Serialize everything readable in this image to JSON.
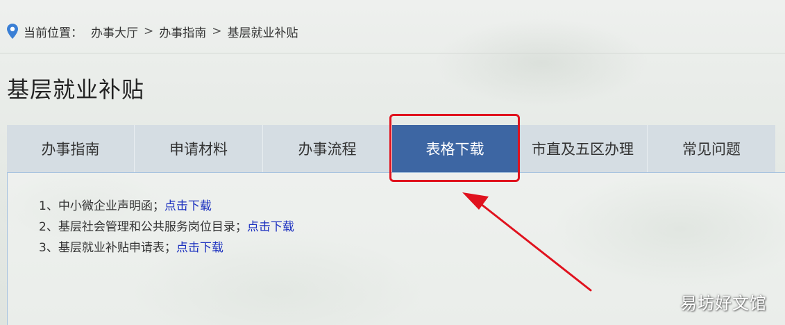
{
  "breadcrumb": {
    "prefix": "当前位置：",
    "items": [
      "办事大厅",
      "办事指南",
      "基层就业补贴"
    ],
    "separator": ">"
  },
  "page": {
    "title": "基层就业补贴"
  },
  "tabs": [
    {
      "label": "办事指南",
      "active": false
    },
    {
      "label": "申请材料",
      "active": false
    },
    {
      "label": "办事流程",
      "active": false
    },
    {
      "label": "表格下载",
      "active": true
    },
    {
      "label": "市直及五区办理",
      "active": false
    },
    {
      "label": "常见问题",
      "active": false
    }
  ],
  "downloads": [
    {
      "text": "1、中小微企业声明函；",
      "link": "点击下载"
    },
    {
      "text": "2、基层社会管理和公共服务岗位目录；",
      "link": "点击下载"
    },
    {
      "text": "3、基层就业补贴申请表；",
      "link": "点击下载"
    }
  ],
  "watermark": "易坊好文馆",
  "colors": {
    "active_tab": "#3d66a3",
    "tab_bg": "#d5dde3",
    "link": "#1a2fbf",
    "annotation": "#e0121e",
    "pin": "#3a7fd5"
  },
  "icons": {
    "location": "map-pin-icon",
    "annotation": "red-arrow"
  }
}
